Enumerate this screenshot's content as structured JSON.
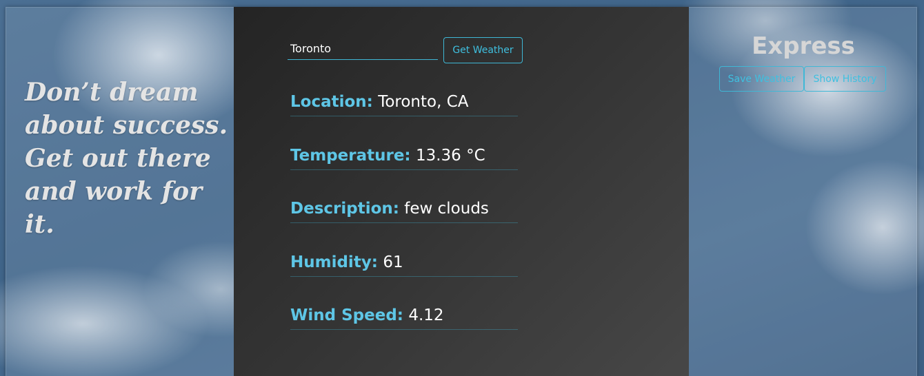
{
  "quote": {
    "text": "Don’t dream about success. Get out there and work for it."
  },
  "search": {
    "value": "Toronto",
    "button_label": "Get Weather"
  },
  "weather": {
    "location": {
      "label": "Location:",
      "value": "Toronto, CA"
    },
    "temperature": {
      "label": "Temperature:",
      "value": "13.36 °C"
    },
    "description": {
      "label": "Description:",
      "value": "few clouds"
    },
    "humidity": {
      "label": "Humidity:",
      "value": "61"
    },
    "wind_speed": {
      "label": "Wind Speed:",
      "value": "4.12"
    }
  },
  "sidebar": {
    "title": "Express",
    "save_label": "Save Weather",
    "history_label": "Show History"
  },
  "colors": {
    "accent": "#3fb8d6",
    "label": "#5ec6e6",
    "panel": "#333333"
  }
}
